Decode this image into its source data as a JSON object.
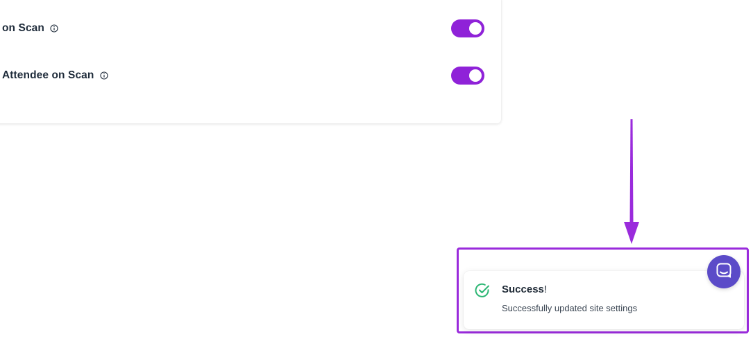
{
  "settings": {
    "rows": [
      {
        "label": "rder on Scan",
        "info_icon": "info-circle-icon",
        "toggle_on": true
      },
      {
        "label": "al Attendee on Scan",
        "info_icon": "info-circle-icon",
        "toggle_on": true
      }
    ]
  },
  "toast": {
    "status_icon": "check-circle-icon",
    "title": "Success",
    "title_suffix": "!",
    "message": "Successfully updated site settings"
  },
  "chat_launcher": {
    "icon": "chat-bubble-icon"
  },
  "colors": {
    "accent": "#8f22d8",
    "annotation": "#9a2bdc",
    "success": "#2bb673",
    "chat": "#5b4bc8"
  }
}
